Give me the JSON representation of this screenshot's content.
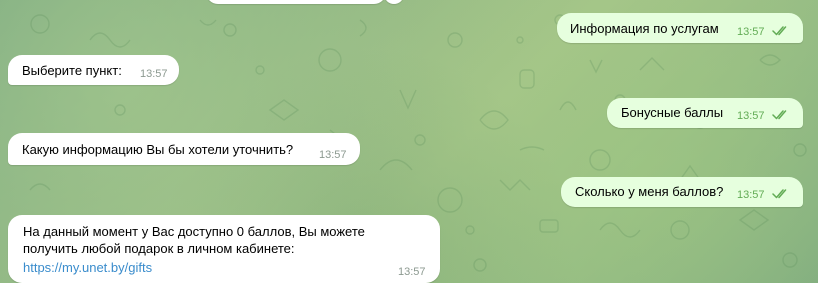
{
  "colors": {
    "incoming_bubble": "#ffffff",
    "outgoing_bubble": "#e6ffde",
    "incoming_time": "#8c9990",
    "outgoing_time": "#62ac55",
    "link": "#3a8ccc",
    "read_check": "#62ac55"
  },
  "messages": [
    {
      "direction": "out",
      "text": "Информация по услугам",
      "time": "13:57",
      "status_icon": "double-check-read-icon"
    },
    {
      "direction": "in",
      "text": "Выберите пункт:",
      "time": "13:57"
    },
    {
      "direction": "out",
      "text": "Бонусные баллы",
      "time": "13:57",
      "status_icon": "double-check-read-icon"
    },
    {
      "direction": "in",
      "text": "Какую информацию Вы бы хотели уточнить?",
      "time": "13:57"
    },
    {
      "direction": "out",
      "text": "Сколько у меня баллов?",
      "time": "13:57",
      "status_icon": "double-check-read-icon"
    },
    {
      "direction": "in",
      "text_line_1": "На данный момент у Вас доступно 0 баллов, Вы можете",
      "text_line_2": "получить любой подарок в личном кабинете:",
      "link": "https://my.unet.by/gifts",
      "time": "13:57"
    }
  ]
}
